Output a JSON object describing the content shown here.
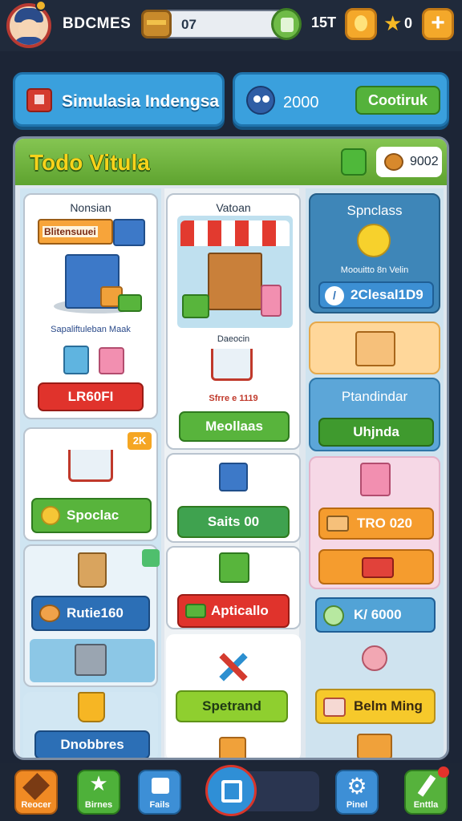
{
  "header": {
    "player_name": "BDCMES",
    "coins": "07",
    "energy": "15T",
    "stars": "0",
    "add_label": "+"
  },
  "banners": {
    "left_title": "Simulasia Indengsa",
    "right_score": "2000",
    "right_button": "Cootiruk"
  },
  "panel": {
    "title": "Todo Vitula",
    "badge_value": "9002"
  },
  "col1": {
    "card1": {
      "title": "Nonsian",
      "sign": "Blitensuuei",
      "caption": "Sapaliftuleban Maak",
      "button": "LR60FI"
    },
    "card2": {
      "badge": "2K",
      "button": "Spoclac"
    },
    "card3": {
      "button": "Rutie160"
    },
    "card4": {
      "button": "Dnobbres"
    }
  },
  "col2": {
    "card1": {
      "title": "Vatoan",
      "label": "Daeocin",
      "price": "Sfrre e 1119",
      "button": "Meollaas"
    },
    "card2": {
      "button": "Saits 00"
    },
    "card3": {
      "button": "Apticallo"
    },
    "card4": {
      "button": "Spetrand"
    }
  },
  "col3": {
    "card1": {
      "title": "Spnclass",
      "caption": "Moouitto 8n Velin",
      "button": "2Clesal1D9"
    },
    "card2": {
      "title": "Ptandindar",
      "button": "Uhjnda"
    },
    "card3": {
      "button": "TRO 020"
    },
    "card4": {
      "button": "K/ 6000"
    },
    "card5": {
      "button": "Belm Ming"
    }
  },
  "bottom_nav": {
    "items": [
      {
        "label": "Reocer"
      },
      {
        "label": "Birnes"
      },
      {
        "label": "Fails"
      },
      {
        "label": ""
      },
      {
        "label": "Pinel"
      },
      {
        "label": "Enttla"
      }
    ]
  }
}
